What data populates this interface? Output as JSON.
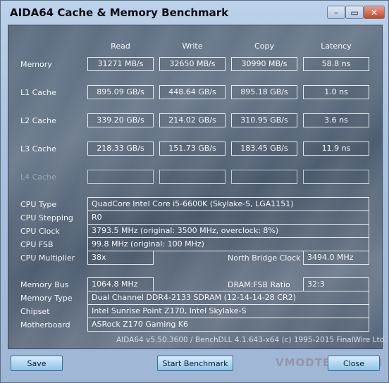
{
  "window": {
    "title": "AIDA64 Cache & Memory Benchmark"
  },
  "titlebar": {
    "min_glyph": "–",
    "max_glyph": "▭",
    "close_glyph": "✕"
  },
  "columns": [
    "Read",
    "Write",
    "Copy",
    "Latency"
  ],
  "rows": [
    {
      "label": "Memory",
      "read": "31271 MB/s",
      "write": "32650 MB/s",
      "copy": "30990 MB/s",
      "latency": "58.8 ns"
    },
    {
      "label": "L1 Cache",
      "read": "895.09 GB/s",
      "write": "448.64 GB/s",
      "copy": "895.18 GB/s",
      "latency": "1.0 ns"
    },
    {
      "label": "L2 Cache",
      "read": "339.20 GB/s",
      "write": "214.02 GB/s",
      "copy": "310.95 GB/s",
      "latency": "3.6 ns"
    },
    {
      "label": "L3 Cache",
      "read": "218.33 GB/s",
      "write": "151.73 GB/s",
      "copy": "183.45 GB/s",
      "latency": "11.9 ns"
    },
    {
      "label": "L4 Cache",
      "read": "",
      "write": "",
      "copy": "",
      "latency": ""
    }
  ],
  "cpu": {
    "type_label": "CPU Type",
    "type": "QuadCore Intel Core i5-6600K  (Skylake-S, LGA1151)",
    "stepping_label": "CPU Stepping",
    "stepping": "R0",
    "clock_label": "CPU Clock",
    "clock": "3793.5 MHz  (original: 3500 MHz, overclock: 8%)",
    "fsb_label": "CPU FSB",
    "fsb": "99.8 MHz  (original: 100 MHz)",
    "multiplier_label": "CPU Multiplier",
    "multiplier": "38x",
    "nb_clock_label": "North Bridge Clock",
    "nb_clock": "3494.0 MHz"
  },
  "memory": {
    "bus_label": "Memory Bus",
    "bus": "1064.8 MHz",
    "ratio_label": "DRAM:FSB Ratio",
    "ratio": "32:3",
    "type_label": "Memory Type",
    "type": "Dual Channel DDR4-2133 SDRAM  (12-14-14-28 CR2)",
    "chipset_label": "Chipset",
    "chipset": "Intel Sunrise Point Z170, Intel Skylake-S",
    "motherboard_label": "Motherboard",
    "motherboard": "ASRock Z170 Gaming K6"
  },
  "footer": "AIDA64 v5.50.3600 / BenchDLL 4.1.643-x64  (c) 1995-2015 FinalWire Ltd.",
  "buttons": {
    "save": "Save",
    "start": "Start Benchmark",
    "close": "Close"
  },
  "watermark": "VMODTECH.COM"
}
